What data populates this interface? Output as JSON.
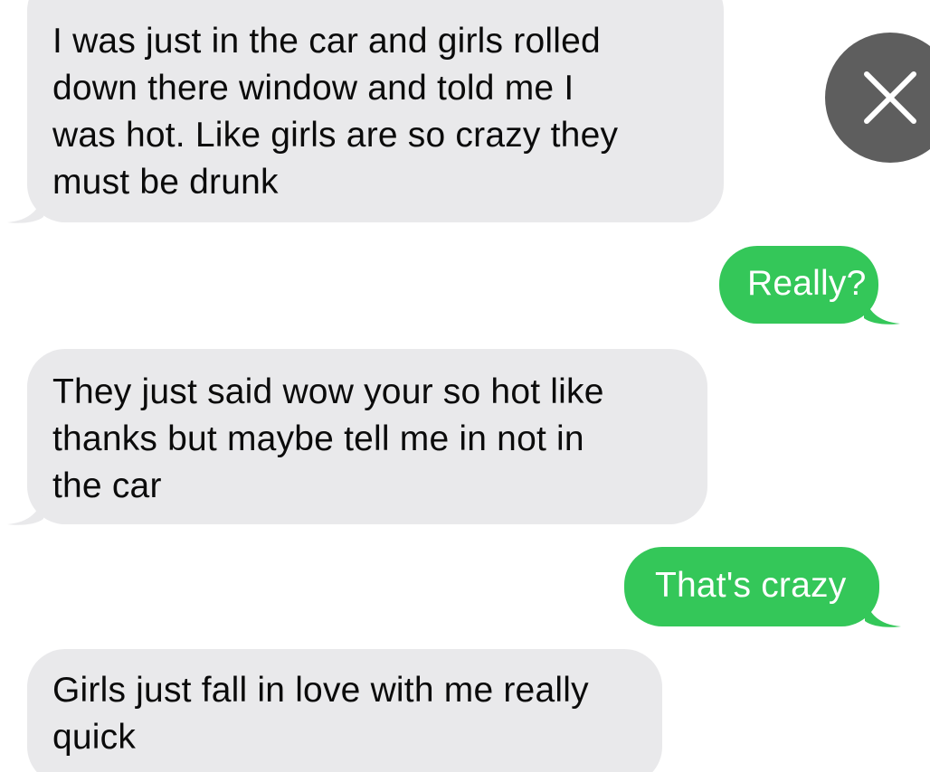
{
  "conversation": {
    "messages": [
      {
        "direction": "incoming",
        "lines": [
          "I was just in the car and girls rolled",
          "down there window and told me I",
          "was hot. Like girls are so crazy they",
          "must be drunk"
        ]
      },
      {
        "direction": "outgoing",
        "lines": [
          "Really?"
        ]
      },
      {
        "direction": "incoming",
        "lines": [
          "They just said wow your so hot like",
          "thanks but maybe tell me in not in",
          "the car"
        ]
      },
      {
        "direction": "outgoing",
        "lines": [
          "That's crazy"
        ]
      },
      {
        "direction": "incoming",
        "lines": [
          "Girls just fall in love with me really",
          "quick"
        ]
      }
    ]
  },
  "overlay": {
    "close_icon": "close-icon"
  },
  "colors": {
    "incoming_bubble": "#e9e9eb",
    "outgoing_bubble": "#34c759",
    "close_button": "#5e5e5e"
  }
}
